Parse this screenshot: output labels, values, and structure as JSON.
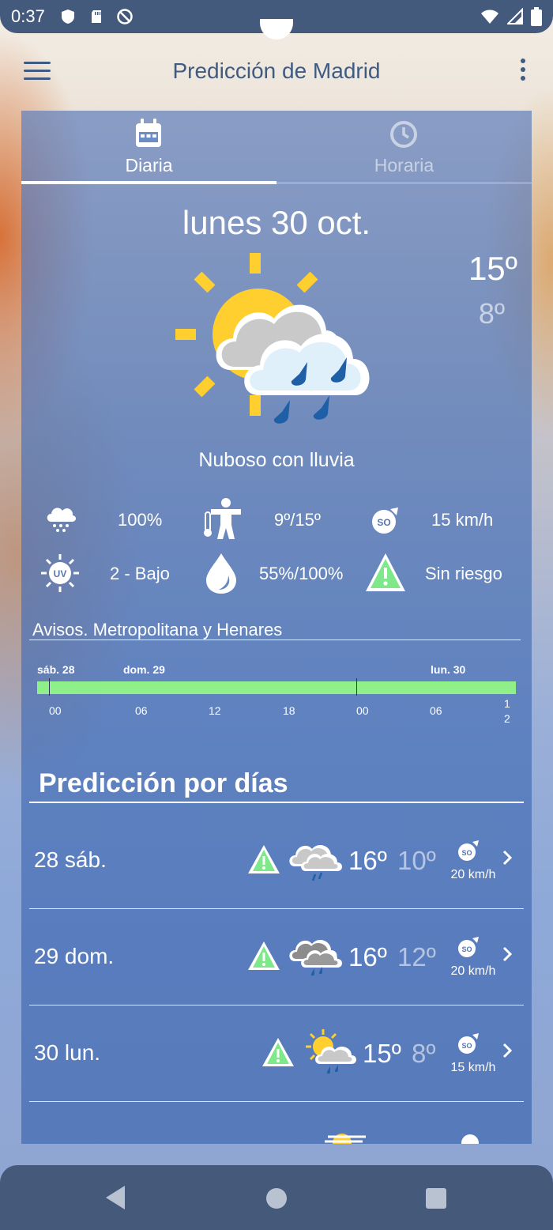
{
  "status": {
    "time": "0:37"
  },
  "app": {
    "title": "Predicción de Madrid"
  },
  "tabs": [
    {
      "label": "Diaria",
      "active": true,
      "icon": "calendar-icon"
    },
    {
      "label": "Horaria",
      "active": false,
      "icon": "clock-icon"
    }
  ],
  "today": {
    "date": "lunes 30 oct.",
    "tmax": "15º",
    "tmin": "8º",
    "description": "Nuboso con lluvia",
    "details": {
      "precip": "100%",
      "thermal": "9º/15º",
      "wind": "15 km/h",
      "uv": "2 - Bajo",
      "humidity": "55%/100%",
      "risk": "Sin riesgo"
    }
  },
  "avisos": {
    "title": "Avisos. Metropolitana y Henares",
    "dates": [
      "sáb. 28",
      "dom. 29",
      "lun. 30"
    ],
    "hours": [
      "00",
      "06",
      "12",
      "18",
      "00",
      "06",
      "1",
      "2"
    ]
  },
  "forecast": {
    "title": "Predicción por días",
    "rows": [
      {
        "day": "28 sáb.",
        "tmax": "16º",
        "tmin": "10º",
        "wind_dir": "SO",
        "wind": "20 km/h"
      },
      {
        "day": "29 dom.",
        "tmax": "16º",
        "tmin": "12º",
        "wind_dir": "SO",
        "wind": "20 km/h"
      },
      {
        "day": "30 lun.",
        "tmax": "15º",
        "tmin": "8º",
        "wind_dir": "SO",
        "wind": "15 km/h"
      }
    ]
  },
  "colors": {
    "accent": "#3f5b82",
    "warning": "#8ff08a",
    "panel": "#466eb4"
  }
}
